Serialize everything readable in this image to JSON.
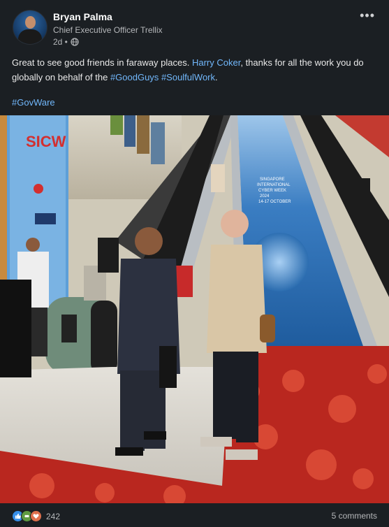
{
  "post": {
    "author_name": "Bryan Palma",
    "author_title": "Chief Executive Officer Trellix",
    "time_ago": "2d •",
    "text_part1": "Great to see good friends in faraway places. ",
    "mention": "Harry Coker",
    "text_part2": ", thanks for all the work you do globally on behalf of the ",
    "hashtag1": "#GoodGuys",
    "hashtag2": "#SoulfulWork",
    "text_end": ".",
    "hashtag_line": "#GovWare"
  },
  "photo": {
    "banner_logo": "SICW",
    "signage": [
      "SINGAPORE",
      "INTERNATIONAL",
      "CYBER WEEK",
      "2024",
      "14-17 OCTOBER"
    ]
  },
  "footer": {
    "reaction_count": "242",
    "comments_label": "5 comments"
  },
  "colors": {
    "background": "#1b1f23",
    "link": "#71b7fb",
    "carpet": "#b9271f",
    "escalator_steps": "#2d6fb3"
  },
  "icons": {
    "more": "more-options-icon",
    "globe": "globe-icon",
    "like": "like-reaction-icon",
    "celebrate": "celebrate-reaction-icon",
    "love": "love-reaction-icon"
  }
}
